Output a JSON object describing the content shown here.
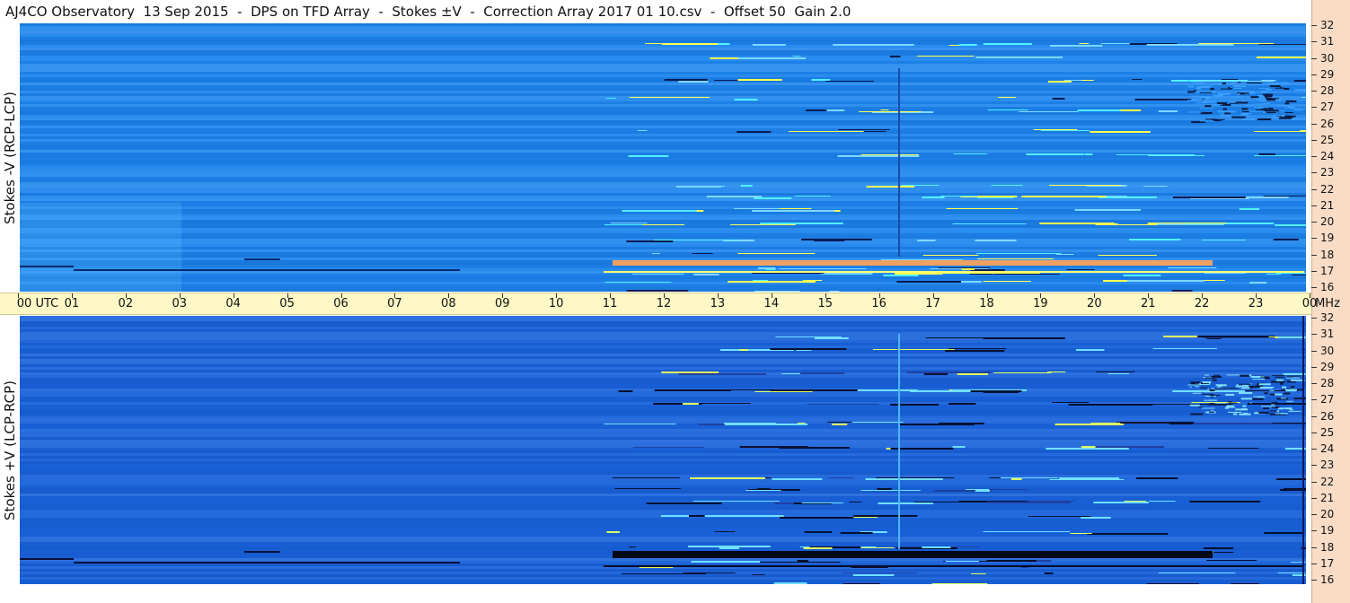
{
  "title": "AJ4CO Observatory  13 Sep 2015  -  DPS on TFD Array  -  Stokes ±V  -  Correction Array 2017 01 10.csv  -  Offset 50  Gain 2.0",
  "panels": {
    "top_label": "Stokes -V (RCP-LCP)",
    "bottom_label": "Stokes +V (LCP-RCP)"
  },
  "utc_axis": {
    "labels": [
      "00  UTC",
      "01",
      "02",
      "03",
      "04",
      "05",
      "06",
      "07",
      "08",
      "09",
      "10",
      "11",
      "12",
      "13",
      "14",
      "15",
      "16",
      "17",
      "18",
      "19",
      "20",
      "21",
      "22",
      "23",
      "00"
    ],
    "unit": "MHz"
  },
  "mhz_axis": {
    "labels": [
      "32",
      "31",
      "30",
      "29",
      "28",
      "27",
      "26",
      "25",
      "24",
      "23",
      "22",
      "21",
      "20",
      "19",
      "18",
      "17",
      "16"
    ]
  },
  "colors": {
    "top_background": "#1e86ee",
    "bottom_background": "#1a63db",
    "utc_bar": "#fdf8c6",
    "right_strip": "#f9dcc6"
  }
}
